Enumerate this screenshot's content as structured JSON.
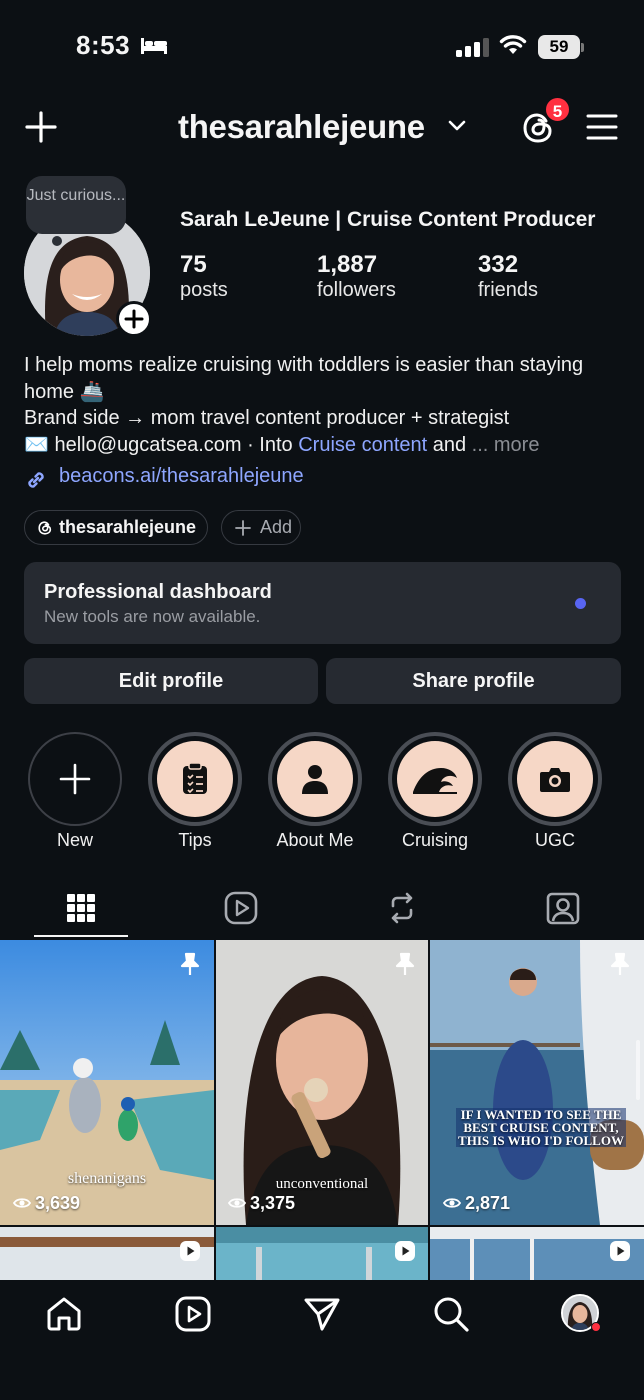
{
  "status_bar": {
    "time": "8:53",
    "battery": "59"
  },
  "header": {
    "username": "thesarahlejeune",
    "notification_count": "5"
  },
  "profile": {
    "note": "Just curious...",
    "full_name": "Sarah LeJeune | Cruise Content Producer",
    "stats": [
      {
        "value": "75",
        "label": "posts"
      },
      {
        "value": "1,887",
        "label": "followers"
      },
      {
        "value": "332",
        "label": "friends"
      }
    ],
    "bio_line1": "I help moms realize cruising with toddlers is easier than staying home 🚢",
    "bio_line2": "Brand side → mom travel content producer + strategist",
    "bio_line3_prefix": "✉️ hello@ugcatsea.com · Into ",
    "bio_line3_link": "Cruise content",
    "bio_line3_suffix": " and ",
    "bio_more": "... more",
    "website": "beacons.ai/thesarahlejeune"
  },
  "chips": {
    "threads": "thesarahlejeune",
    "add": "Add"
  },
  "dashboard": {
    "title": "Professional dashboard",
    "subtitle": "New tools are now available."
  },
  "buttons": {
    "edit": "Edit profile",
    "share": "Share profile"
  },
  "highlights": [
    {
      "label": "New",
      "icon": "plus-icon"
    },
    {
      "label": "Tips",
      "icon": "clipboard-icon"
    },
    {
      "label": "About Me",
      "icon": "person-icon"
    },
    {
      "label": "Cruising",
      "icon": "wave-icon"
    },
    {
      "label": "UGC",
      "icon": "camera-icon"
    }
  ],
  "tabs": [
    "grid-icon",
    "reels-icon",
    "reposts-icon",
    "tagged-icon"
  ],
  "posts": [
    {
      "views": "3,639",
      "caption": "shenanigans",
      "pinned": true
    },
    {
      "views": "3,375",
      "caption": "unconventional",
      "pinned": true
    },
    {
      "views": "2,871",
      "caption": "IF I WANTED TO SEE THE BEST CRUISE CONTENT, THIS IS WHO I'D FOLLOW",
      "pinned": true
    }
  ],
  "bottom_nav": [
    "home-icon",
    "reels-icon",
    "send-icon",
    "search-icon",
    "profile-avatar"
  ],
  "colors": {
    "background": "#0c1014",
    "accent_blue": "#8ea6ff",
    "badge_red": "#ff3040",
    "highlight_bg": "#f6d7c6"
  }
}
